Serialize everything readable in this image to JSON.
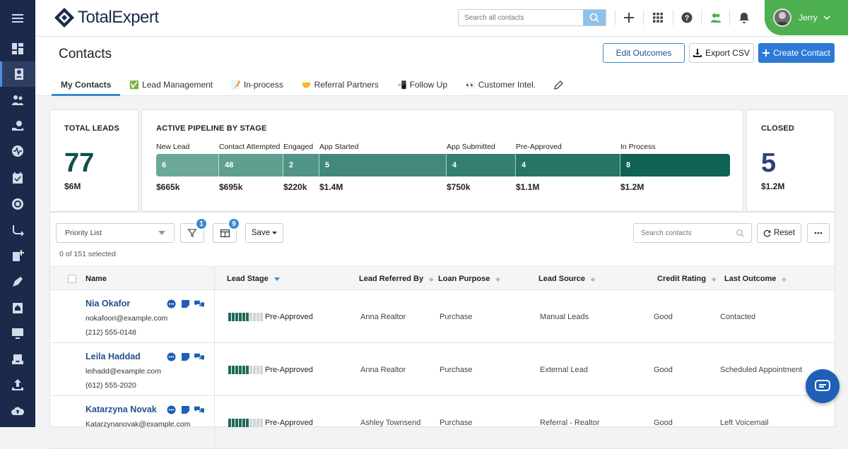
{
  "brand": {
    "name": "TotalExpert"
  },
  "topbar": {
    "search_placeholder": "Search all contacts",
    "user_name": "Jerry"
  },
  "header": {
    "title": "Contacts",
    "buttons": {
      "edit_outcomes": "Edit Outcomes",
      "export_csv": "Export CSV",
      "create_contact": "Create Contact"
    },
    "tabs": [
      {
        "label": "My Contacts",
        "emoji": ""
      },
      {
        "label": "Lead Management",
        "emoji": "✅"
      },
      {
        "label": "In-process",
        "emoji": "📝"
      },
      {
        "label": "Referral Partners",
        "emoji": "🤝"
      },
      {
        "label": "Follow Up",
        "emoji": "📲"
      },
      {
        "label": "Customer Intel.",
        "emoji": "👀"
      }
    ]
  },
  "stats": {
    "total_leads": {
      "label": "TOTAL LEADS",
      "value": "77",
      "amount": "$6M"
    },
    "pipeline": {
      "label": "ACTIVE PIPELINE BY STAGE",
      "stages": [
        {
          "name": "New Lead",
          "count": "6",
          "amount": "$665k",
          "color": "#6ba89a"
        },
        {
          "name": "Contact Attempted",
          "count": "48",
          "amount": "$695k",
          "color": "#5f9f90"
        },
        {
          "name": "Engaged",
          "count": "2",
          "amount": "$220k",
          "color": "#4f9484"
        },
        {
          "name": "App Started",
          "count": "5",
          "amount": "$1.4M",
          "color": "#42897a"
        },
        {
          "name": "App Submitted",
          "count": "4",
          "amount": "$750k",
          "color": "#347f6f"
        },
        {
          "name": "Pre-Approved",
          "count": "4",
          "amount": "$1.1M",
          "color": "#277565"
        },
        {
          "name": "In Process",
          "count": "8",
          "amount": "$1.2M",
          "color": "#0f6255"
        }
      ]
    },
    "closed": {
      "label": "CLOSED",
      "value": "5",
      "amount": "$1.2M"
    }
  },
  "list": {
    "filter_select": "Priority List",
    "filter_badge": "1",
    "columns_badge": "9",
    "save_label": "Save",
    "search_placeholder": "Search contacts",
    "reset_label": "Reset",
    "selected_text": "0 of 151 selected",
    "columns": [
      "Name",
      "Lead Stage",
      "Lead Referred By",
      "Loan Purpose",
      "Lead Source",
      "Credit Rating",
      "Last Outcome"
    ],
    "rows": [
      {
        "name": "Nia Okafor",
        "email": "nokafoori@example.com",
        "phone": "(212) 555-0148",
        "stage": "Pre-Approved",
        "referred_by": "Anna Realtor",
        "purpose": "Purchase",
        "source": "Manual Leads",
        "credit": "Good",
        "outcome": "Contacted",
        "progress": 0.6
      },
      {
        "name": "Leila Haddad",
        "email": "leihadd@example.com",
        "phone": "(612) 555-2020",
        "stage": "Pre-Approved",
        "referred_by": "Anna Realtor",
        "purpose": "Purchase",
        "source": "External Lead",
        "credit": "Good",
        "outcome": "Scheduled Appointment",
        "progress": 0.6
      },
      {
        "name": "Katarzyna Novak",
        "email": "Katarzynanovak@example.com",
        "phone": "",
        "stage": "Pre-Approved",
        "referred_by": "Ashley Townsend",
        "purpose": "Purchase",
        "source": "Referral - Realtor",
        "credit": "Good",
        "outcome": "Left Voicemail",
        "progress": 0.6
      }
    ]
  },
  "colors": {
    "sidebar": "#1b2a4a",
    "accent": "#3a8bd1",
    "pipeline_dark": "#0f6255",
    "closed_value": "#2f3f7a",
    "total_value": "#0f4f4a",
    "user_badge": "#4caf50"
  }
}
